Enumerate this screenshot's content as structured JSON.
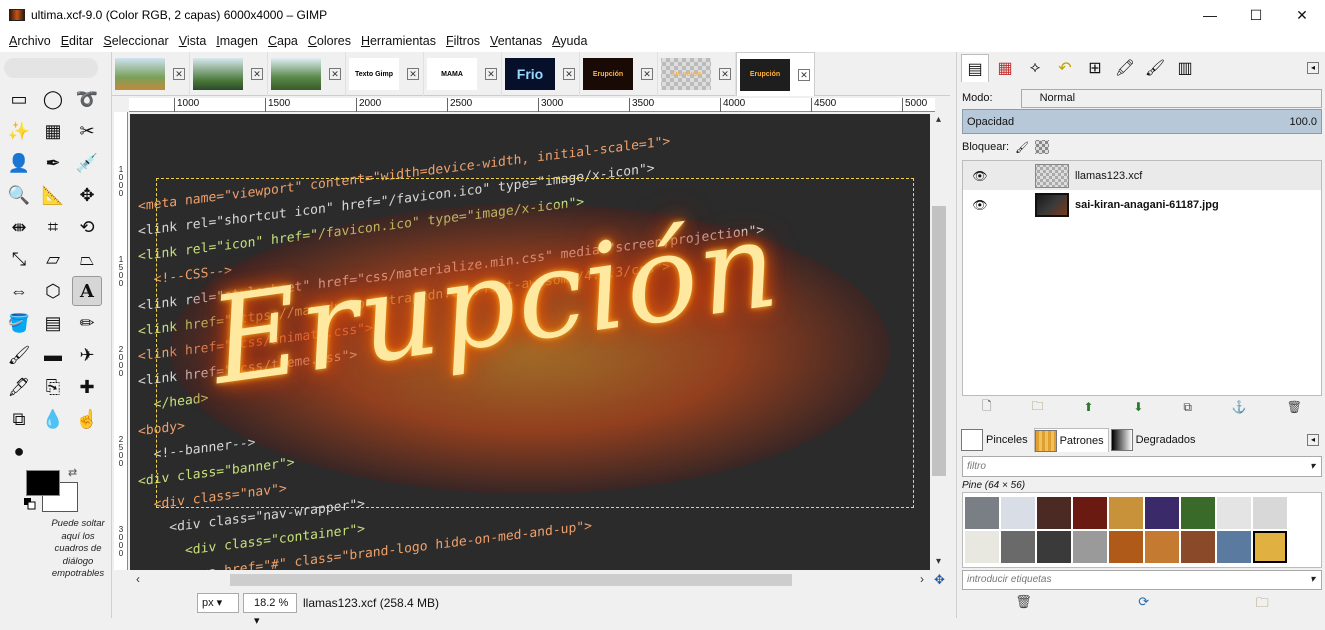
{
  "window": {
    "title": "ultima.xcf-9.0 (Color RGB, 2 capas) 6000x4000 – GIMP",
    "minimize": "—",
    "maximize": "☐",
    "close": "✕"
  },
  "menu": [
    "Archivo",
    "Editar",
    "Seleccionar",
    "Vista",
    "Imagen",
    "Capa",
    "Colores",
    "Herramientas",
    "Filtros",
    "Ventanas",
    "Ayuda"
  ],
  "toolbox": {
    "tools": [
      {
        "name": "rect-select-icon",
        "glyph": "▭"
      },
      {
        "name": "ellipse-select-icon",
        "glyph": "◯"
      },
      {
        "name": "free-select-icon",
        "glyph": "➰"
      },
      {
        "name": "fuzzy-select-icon",
        "glyph": "✨"
      },
      {
        "name": "select-by-color-icon",
        "glyph": "▦"
      },
      {
        "name": "scissors-icon",
        "glyph": "✂"
      },
      {
        "name": "foreground-select-icon",
        "glyph": "👤"
      },
      {
        "name": "paths-icon",
        "glyph": "✒"
      },
      {
        "name": "color-picker-icon",
        "glyph": "💉"
      },
      {
        "name": "zoom-icon",
        "glyph": "🔍"
      },
      {
        "name": "measure-icon",
        "glyph": "📐"
      },
      {
        "name": "move-icon",
        "glyph": "✥"
      },
      {
        "name": "align-icon",
        "glyph": "⇼"
      },
      {
        "name": "crop-icon",
        "glyph": "⌗"
      },
      {
        "name": "rotate-icon",
        "glyph": "⟲"
      },
      {
        "name": "scale-icon",
        "glyph": "⤡"
      },
      {
        "name": "shear-icon",
        "glyph": "▱"
      },
      {
        "name": "perspective-icon",
        "glyph": "⏢"
      },
      {
        "name": "flip-icon",
        "glyph": "⇔"
      },
      {
        "name": "cage-icon",
        "glyph": "⬡"
      },
      {
        "name": "text-icon",
        "glyph": "A"
      },
      {
        "name": "bucket-fill-icon",
        "glyph": "🪣"
      },
      {
        "name": "gradient-icon",
        "glyph": "▤"
      },
      {
        "name": "pencil-icon",
        "glyph": "✏"
      },
      {
        "name": "paintbrush-icon",
        "glyph": "🖌"
      },
      {
        "name": "eraser-icon",
        "glyph": "▬"
      },
      {
        "name": "airbrush-icon",
        "glyph": "✈"
      },
      {
        "name": "ink-icon",
        "glyph": "🖋"
      },
      {
        "name": "clone-icon",
        "glyph": "⎘"
      },
      {
        "name": "heal-icon",
        "glyph": "✚"
      },
      {
        "name": "perspective-clone-icon",
        "glyph": "⧉"
      },
      {
        "name": "blur-icon",
        "glyph": "💧"
      },
      {
        "name": "smudge-icon",
        "glyph": "☝"
      },
      {
        "name": "dodge-burn-icon",
        "glyph": "●"
      }
    ],
    "drop_hint": "Puede soltar aquí los cuadros de diálogo empotrables"
  },
  "image_tabs": [
    {
      "label": "",
      "color": "linear-gradient(#cfe3f2,#7aa05a 60%,#c08a3a)"
    },
    {
      "label": "",
      "color": "linear-gradient(#d8e8f0,#4a7a3a 70%,#2a4a2a)"
    },
    {
      "label": "",
      "color": "linear-gradient(#e0eef6,#5a8a4a 60%,#3a5a2a)"
    },
    {
      "label": "Texto Gimp",
      "color": "#ffffff"
    },
    {
      "label": "MAMA",
      "color": "#ffffff"
    },
    {
      "label": "Frio",
      "color": "#06102a"
    },
    {
      "label": "Erupción",
      "color": "#1a0a05"
    },
    {
      "label": "Erupción",
      "color": "repeating-conic-gradient(#bbb 0% 25%, #ddd 0% 50%) 50% / 8px 8px"
    },
    {
      "label": "Erupción",
      "color": "#1e1e1e"
    }
  ],
  "rulers": {
    "h_ticks": [
      "1000",
      "1500",
      "2000",
      "2500",
      "3000",
      "3500",
      "4000",
      "4500",
      "5000"
    ],
    "v_ticks": [
      "1000",
      "1500",
      "2000",
      "2500",
      "3000"
    ]
  },
  "canvas": {
    "code_lines": [
      "<meta name=\"viewport\" content=\"width=device-width, initial-scale=1\">",
      "<link rel=\"shortcut icon\" href=\"/favicon.ico\" type=\"image/x-icon\">",
      "<link rel=\"icon\" href=\"/favicon.ico\" type=\"image/x-icon\">",
      "  <!--CSS-->",
      "<link rel=\"stylesheet\" href=\"css/materialize.min.css\" media=\"screen,projection\">",
      "<link href=\"https://maxcdn.bootstrapcdn.com/font-awesome/4.6.3/css\">",
      "<link href=\"/css/animate.css\">",
      "<link href=\"/css/theme.css\">",
      "  </head>",
      "<body>",
      "  <!--banner-->",
      "<div class=\"banner\">",
      "  <div class=\"nav\">",
      "    <div class=\"nav-wrapper\">",
      "      <div class=\"container\">",
      "        <a href=\"#\" class=\"brand-logo hide-on-med-and-up\">"
    ],
    "fire_text": "Erupción"
  },
  "statusbar": {
    "unit": "px",
    "zoom": "18.2 %",
    "info": "llamas123.xcf (258.4 MB)"
  },
  "layers_dock": {
    "mode_label": "Modo:",
    "mode_value": "Normal",
    "opacity_label": "Opacidad",
    "opacity_value": "100.0",
    "lock_label": "Bloquear:",
    "layers": [
      {
        "name": "llamas123.xcf",
        "selected": true,
        "thumb": "repeating-conic-gradient(#aaa 0% 25%, #ddd 0% 50%) 50% / 6px 6px"
      },
      {
        "name": "sai-kiran-anagani-61187.jpg",
        "selected": false,
        "thumb": "linear-gradient(135deg,#1a1a1a,#3a3a3a 50%,#7a3a1a)"
      }
    ]
  },
  "resources_dock": {
    "tabs": [
      "Pinceles",
      "Patrones",
      "Degradados"
    ],
    "filter_placeholder": "filtro",
    "pattern_name": "Pine (64 × 56)",
    "tags_placeholder": "introducir etiquetas",
    "patterns": [
      "#7a7f86",
      "#d9dde6",
      "#4a2a22",
      "#6a1a10",
      "#c8923a",
      "#3a2a6a",
      "#3a6a2a",
      "#e4e4e4",
      "#d8d8d8",
      "#e8e8e0",
      "#6a6a6a",
      "#3a3a3a",
      "#9a9a9a",
      "#b05a1a",
      "#c47a30",
      "#8a4a2a",
      "#5a7aa0",
      "#e0b040"
    ]
  }
}
